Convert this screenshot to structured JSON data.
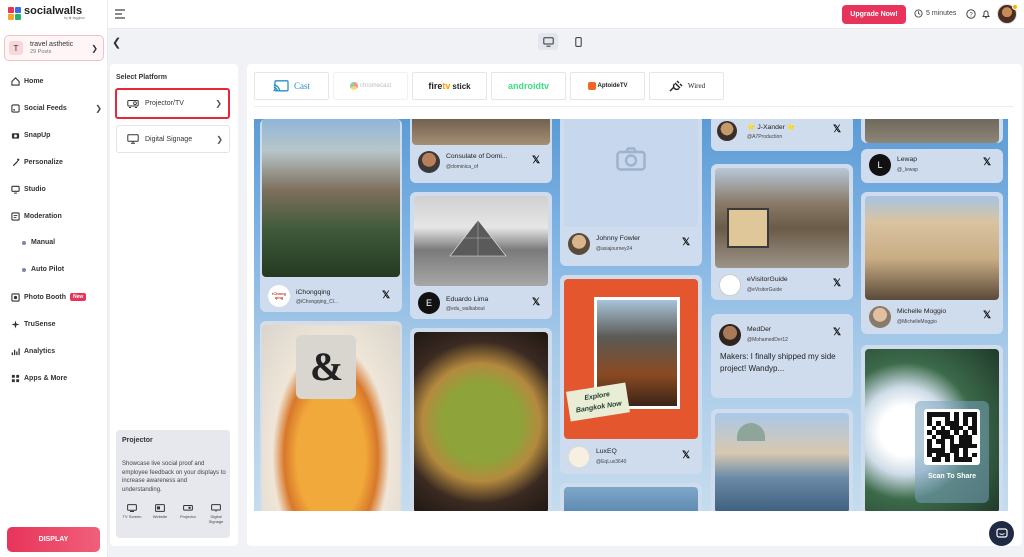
{
  "app": {
    "logo_text": "socialwalls",
    "logo_sub": "by ❀ taggbox"
  },
  "workspace": {
    "initial": "T",
    "name": "travel asthetic",
    "posts": "29 Posts"
  },
  "nav": {
    "home": "Home",
    "social_feeds": "Social Feeds",
    "snapup": "SnapUp",
    "personalize": "Personalize",
    "studio": "Studio",
    "moderation": "Moderation",
    "manual": "Manual",
    "auto_pilot": "Auto Pilot",
    "photo_booth": "Photo Booth",
    "photo_booth_badge": "New",
    "trusense": "TruSense",
    "analytics": "Analytics",
    "apps_more": "Apps & More"
  },
  "display_button": "DISPLAY",
  "topbar": {
    "upgrade": "Upgrade Now!",
    "timer": "5 minutes"
  },
  "platform": {
    "title": "Select Platform",
    "items": [
      {
        "label": "Projector/TV",
        "selected": true
      },
      {
        "label": "Digital Signage",
        "selected": false
      }
    ],
    "info": {
      "title": "Projector",
      "description": "Showcase live social proof and employee feedback on your displays to increase awareness and understanding.",
      "icons": [
        {
          "label": "TV Screen",
          "icon": "tv-icon"
        },
        {
          "label": "Website",
          "icon": "website-icon"
        },
        {
          "label": "Projector",
          "icon": "projector-icon"
        },
        {
          "label": "Digital Signage",
          "icon": "signage-icon"
        }
      ]
    }
  },
  "cast_options": {
    "cast": "Cast",
    "chromecast": "chromecast",
    "firetv_fire": "fire",
    "firetv_tv": "tv",
    "firetv_stick": "stick",
    "androidtv": "androidtv",
    "aptoide": "AptoideTV",
    "wired": "Wired"
  },
  "posts": {
    "c1": {
      "author": "iChongqing",
      "handle": "@iChongqing_Cl...",
      "avatar_text": "iChong\nqing"
    },
    "c2": {
      "author": "Consulate of Domi...",
      "handle": "@dominica_of"
    },
    "c3": {
      "author": "Eduardo Lima",
      "handle": "@edu_walkabout",
      "avatar_text": "E"
    },
    "c4": {
      "author": "Johnny Fowler",
      "handle": "@asiajourney24"
    },
    "c5": {
      "author": "LuxEQ",
      "handle": "@EqLux3640",
      "overlay_line1": "Explore",
      "overlay_line2": "Bangkok Now"
    },
    "c6": {
      "author": "⭐ J-Xander ⭐",
      "handle": "@A7Production"
    },
    "c7": {
      "author": "eVisitorGuide",
      "handle": "@eVisitorGuide"
    },
    "c8": {
      "author": "MedDer",
      "handle": "@MohamedDer12",
      "text": "Makers: I finally shipped my side project! Wandyp..."
    },
    "c9": {
      "author": "Lewap",
      "handle": "@_lewap",
      "avatar_text": "L"
    },
    "c10": {
      "author": "Michelle Moggio",
      "handle": "@MichelleMoggio"
    }
  },
  "qr_label": "Scan To Share",
  "x_glyph": "𝕏"
}
